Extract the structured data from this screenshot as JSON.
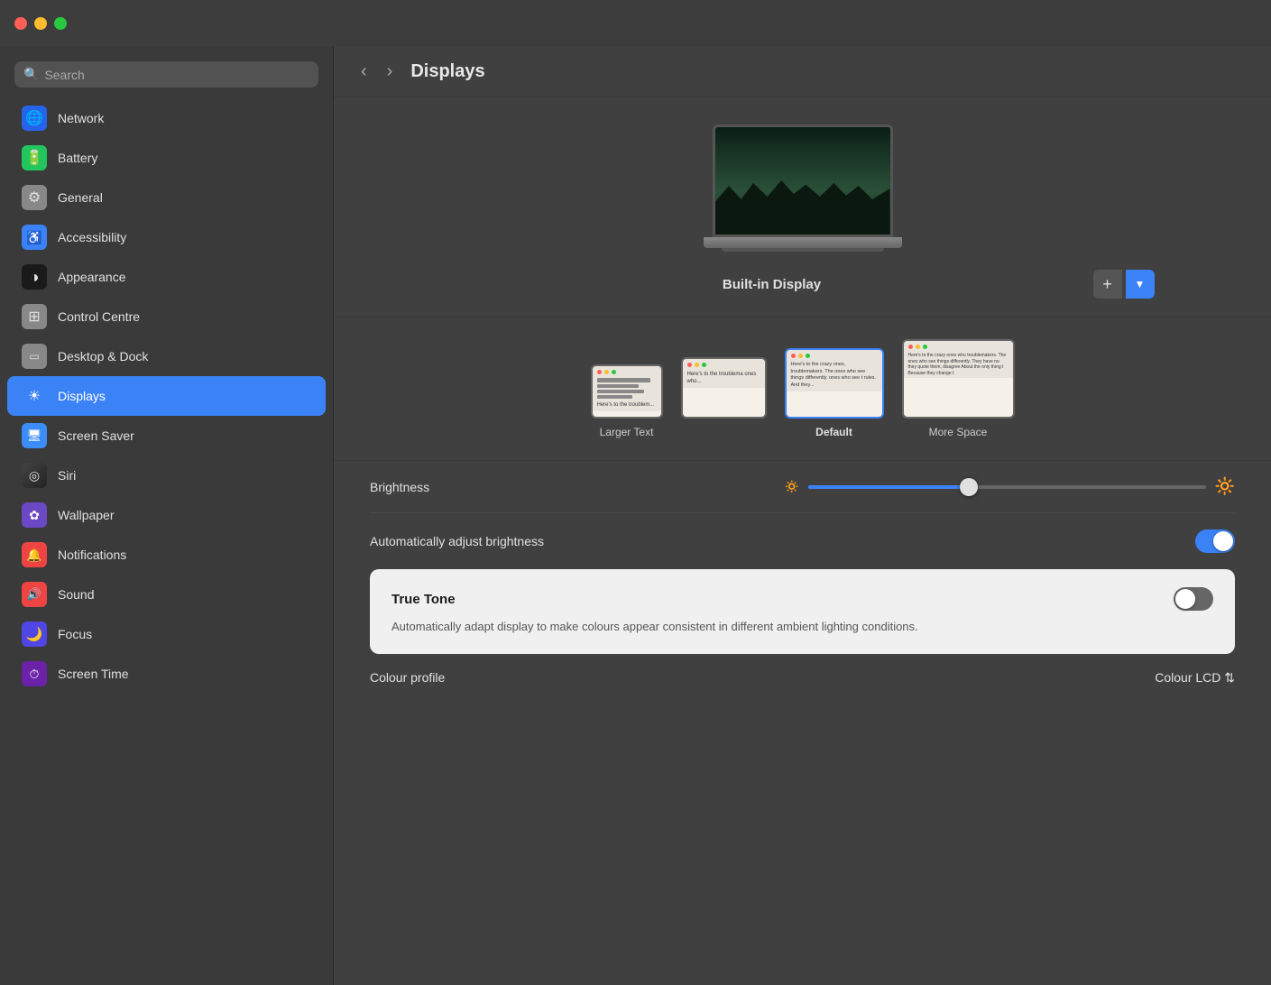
{
  "titlebar": {
    "traffic_close": "close",
    "traffic_minimize": "minimize",
    "traffic_maximize": "maximize"
  },
  "sidebar": {
    "search_placeholder": "Search",
    "items": [
      {
        "id": "network",
        "label": "Network",
        "icon": "🌐",
        "icon_class": "icon-network",
        "active": false
      },
      {
        "id": "battery",
        "label": "Battery",
        "icon": "🔋",
        "icon_class": "icon-battery",
        "active": false
      },
      {
        "id": "general",
        "label": "General",
        "icon": "⚙️",
        "icon_class": "icon-general",
        "active": false
      },
      {
        "id": "accessibility",
        "label": "Accessibility",
        "icon": "♿",
        "icon_class": "icon-accessibility",
        "active": false
      },
      {
        "id": "appearance",
        "label": "Appearance",
        "icon": "◑",
        "icon_class": "icon-appearance",
        "active": false
      },
      {
        "id": "controlcentre",
        "label": "Control Centre",
        "icon": "▦",
        "icon_class": "icon-controlcentre",
        "active": false
      },
      {
        "id": "desktopanddock",
        "label": "Desktop & Dock",
        "icon": "▭",
        "icon_class": "icon-dock",
        "active": false
      },
      {
        "id": "displays",
        "label": "Displays",
        "icon": "☀",
        "icon_class": "icon-displays",
        "active": true
      },
      {
        "id": "screensaver",
        "label": "Screen Saver",
        "icon": "🖥",
        "icon_class": "icon-screensaver",
        "active": false
      },
      {
        "id": "siri",
        "label": "Siri",
        "icon": "◎",
        "icon_class": "icon-siri",
        "active": false
      },
      {
        "id": "wallpaper",
        "label": "Wallpaper",
        "icon": "✿",
        "icon_class": "icon-wallpaper",
        "active": false
      },
      {
        "id": "notifications",
        "label": "Notifications",
        "icon": "🔔",
        "icon_class": "icon-notifications",
        "active": false
      },
      {
        "id": "sound",
        "label": "Sound",
        "icon": "🔊",
        "icon_class": "icon-sound",
        "active": false
      },
      {
        "id": "focus",
        "label": "Focus",
        "icon": "🌙",
        "icon_class": "icon-focus",
        "active": false
      },
      {
        "id": "screentime",
        "label": "Screen Time",
        "icon": "⏱",
        "icon_class": "icon-screentime",
        "active": false
      }
    ]
  },
  "content": {
    "title": "Displays",
    "nav_back": "‹",
    "nav_forward": "›",
    "display_label": "Built-in Display",
    "add_btn_label": "+",
    "chevron_down": "▼",
    "resolution_options": [
      {
        "id": "larger-text",
        "label": "Larger Text",
        "selected": false
      },
      {
        "id": "option2",
        "label": "",
        "selected": false
      },
      {
        "id": "default",
        "label": "Default",
        "selected": true
      },
      {
        "id": "more-space",
        "label": "More Space",
        "selected": false
      }
    ],
    "brightness_label": "Brightness",
    "brightness_value": 38,
    "auto_brightness_label": "Automatically adjust brightness",
    "auto_brightness_on": true,
    "true_tone_title": "True Tone",
    "true_tone_desc": "Automatically adapt display to make colours appear consistent in different ambient lighting conditions.",
    "true_tone_on": false,
    "colour_profile_label": "Colour profile",
    "colour_profile_value": "Colour LCD ⇅"
  }
}
